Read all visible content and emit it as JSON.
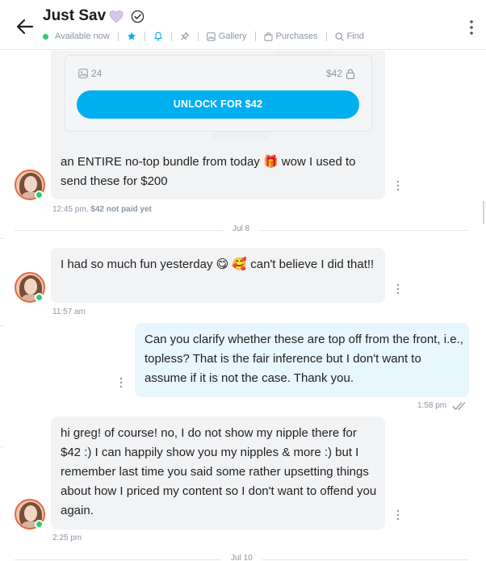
{
  "header": {
    "title": "Just Sav",
    "status": "Available now",
    "links": {
      "gallery": "Gallery",
      "purchases": "Purchases",
      "find": "Find"
    }
  },
  "ppv": {
    "media_count": "24",
    "price": "$42",
    "unlock_label": "UNLOCK FOR $42"
  },
  "messages": [
    {
      "direction": "in",
      "text": "an ENTIRE no-top bundle from today 🎁 wow I used to send these for $200",
      "time": "12:45 pm,",
      "note": "$42 not paid yet"
    },
    {
      "direction": "in",
      "text": "I had so much fun yesterday 😋 🥰 can't believe I did that!!",
      "time": "11:57 am"
    },
    {
      "direction": "out",
      "text": "Can you clarify whether these are top off from the front, i.e., topless? That is the fair inference but I don't want to assume if it is not the case. Thank you.",
      "time": "1:58 pm"
    },
    {
      "direction": "in",
      "text": "hi greg! of course! no, I do not show my nipple there for $42 :) I can happily show you my nipples & more :) but I remember last time you said some rather upsetting things about how I priced my content so I don't want to offend you again.",
      "time": "2:25 pm"
    }
  ],
  "dates": {
    "d1": "Jul 8",
    "d2": "Jul 10"
  },
  "colors": {
    "accent": "#00aff0",
    "online": "#2ecc71",
    "incoming_bubble": "#f2f3f5",
    "outgoing_bubble": "#e8f6fe"
  }
}
